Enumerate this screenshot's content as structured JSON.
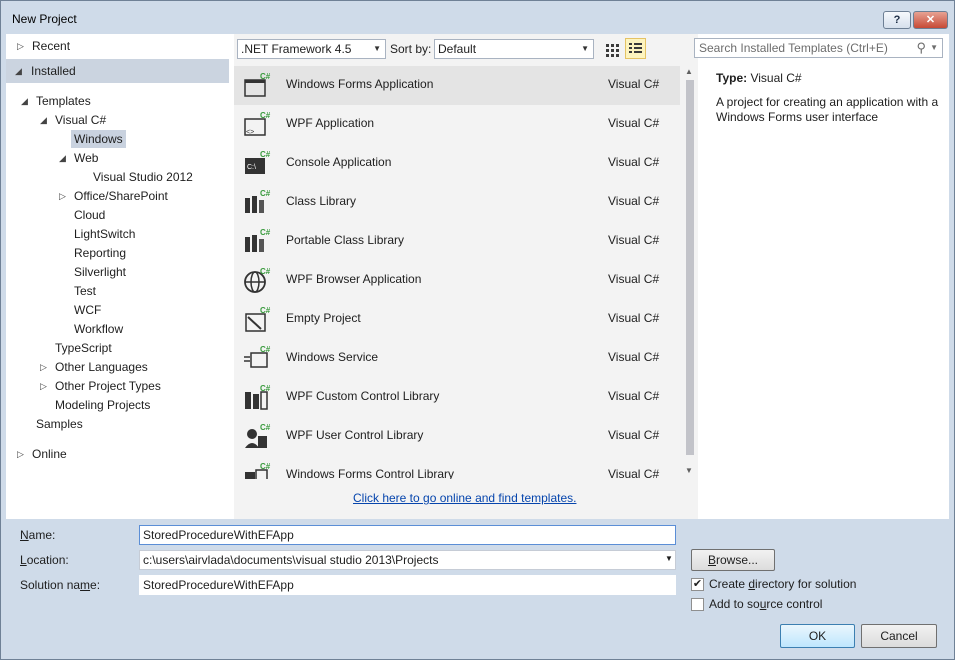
{
  "window": {
    "title": "New Project",
    "help_label": "?",
    "close_label": "✕"
  },
  "sidebar": {
    "recent": "Recent",
    "installed": "Installed",
    "online": "Online",
    "tree": [
      {
        "label": "Templates",
        "indent": 1,
        "arrow": "▲",
        "selected": false
      },
      {
        "label": "Visual C#",
        "indent": 2,
        "arrow": "▲",
        "selected": false
      },
      {
        "label": "Windows",
        "indent": 3,
        "arrow": "",
        "selected": true
      },
      {
        "label": "Web",
        "indent": 3,
        "arrow": "▲",
        "selected": false
      },
      {
        "label": "Visual Studio 2012",
        "indent": 4,
        "arrow": "",
        "selected": false
      },
      {
        "label": "Office/SharePoint",
        "indent": 3,
        "arrow": "▷",
        "selected": false
      },
      {
        "label": "Cloud",
        "indent": 3,
        "arrow": "",
        "selected": false
      },
      {
        "label": "LightSwitch",
        "indent": 3,
        "arrow": "",
        "selected": false
      },
      {
        "label": "Reporting",
        "indent": 3,
        "arrow": "",
        "selected": false
      },
      {
        "label": "Silverlight",
        "indent": 3,
        "arrow": "",
        "selected": false
      },
      {
        "label": "Test",
        "indent": 3,
        "arrow": "",
        "selected": false
      },
      {
        "label": "WCF",
        "indent": 3,
        "arrow": "",
        "selected": false
      },
      {
        "label": "Workflow",
        "indent": 3,
        "arrow": "",
        "selected": false
      },
      {
        "label": "TypeScript",
        "indent": 2,
        "arrow": "",
        "selected": false
      },
      {
        "label": "Other Languages",
        "indent": 2,
        "arrow": "▷",
        "selected": false
      },
      {
        "label": "Other Project Types",
        "indent": 2,
        "arrow": "▷",
        "selected": false
      },
      {
        "label": "Modeling Projects",
        "indent": 2,
        "arrow": "",
        "selected": false
      },
      {
        "label": "Samples",
        "indent": 1,
        "arrow": "",
        "selected": false
      }
    ]
  },
  "toolbar": {
    "framework": ".NET Framework 4.5",
    "sort_label": "Sort by:",
    "sort_value": "Default",
    "search_placeholder": "Search Installed Templates (Ctrl+E)"
  },
  "templates": [
    {
      "name": "Windows Forms Application",
      "lang": "Visual C#",
      "icon": "windows-forms-icon",
      "selected": true
    },
    {
      "name": "WPF Application",
      "lang": "Visual C#",
      "icon": "wpf-application-icon",
      "selected": false
    },
    {
      "name": "Console Application",
      "lang": "Visual C#",
      "icon": "console-icon",
      "selected": false
    },
    {
      "name": "Class Library",
      "lang": "Visual C#",
      "icon": "class-library-icon",
      "selected": false
    },
    {
      "name": "Portable Class Library",
      "lang": "Visual C#",
      "icon": "portable-library-icon",
      "selected": false
    },
    {
      "name": "WPF Browser Application",
      "lang": "Visual C#",
      "icon": "globe-icon",
      "selected": false
    },
    {
      "name": "Empty Project",
      "lang": "Visual C#",
      "icon": "empty-project-icon",
      "selected": false
    },
    {
      "name": "Windows Service",
      "lang": "Visual C#",
      "icon": "service-icon",
      "selected": false
    },
    {
      "name": "WPF Custom Control Library",
      "lang": "Visual C#",
      "icon": "custom-control-icon",
      "selected": false
    },
    {
      "name": "WPF User Control Library",
      "lang": "Visual C#",
      "icon": "user-control-icon",
      "selected": false
    },
    {
      "name": "Windows Forms Control Library",
      "lang": "Visual C#",
      "icon": "forms-control-icon",
      "selected": false
    }
  ],
  "online_link": "Click here to go online and find templates.",
  "details": {
    "type_label": "Type:",
    "type_value": "Visual C#",
    "description": "A project for creating an application with a Windows Forms user interface"
  },
  "form": {
    "name_label": "Name:",
    "name_value": "StoredProcedureWithEFApp",
    "location_label": "Location:",
    "location_value": "c:\\users\\airvlada\\documents\\visual studio 2013\\Projects",
    "solution_label": "Solution name:",
    "solution_value": "StoredProcedureWithEFApp",
    "browse_label": "Browse...",
    "create_dir_label": "Create directory for solution",
    "create_dir_checked": true,
    "source_control_label": "Add to source control",
    "source_control_checked": false,
    "ok_label": "OK",
    "cancel_label": "Cancel"
  },
  "colors": {
    "accent": "#3c7fb1",
    "csharp_badge": "#389a3c",
    "link": "#0645ad"
  }
}
